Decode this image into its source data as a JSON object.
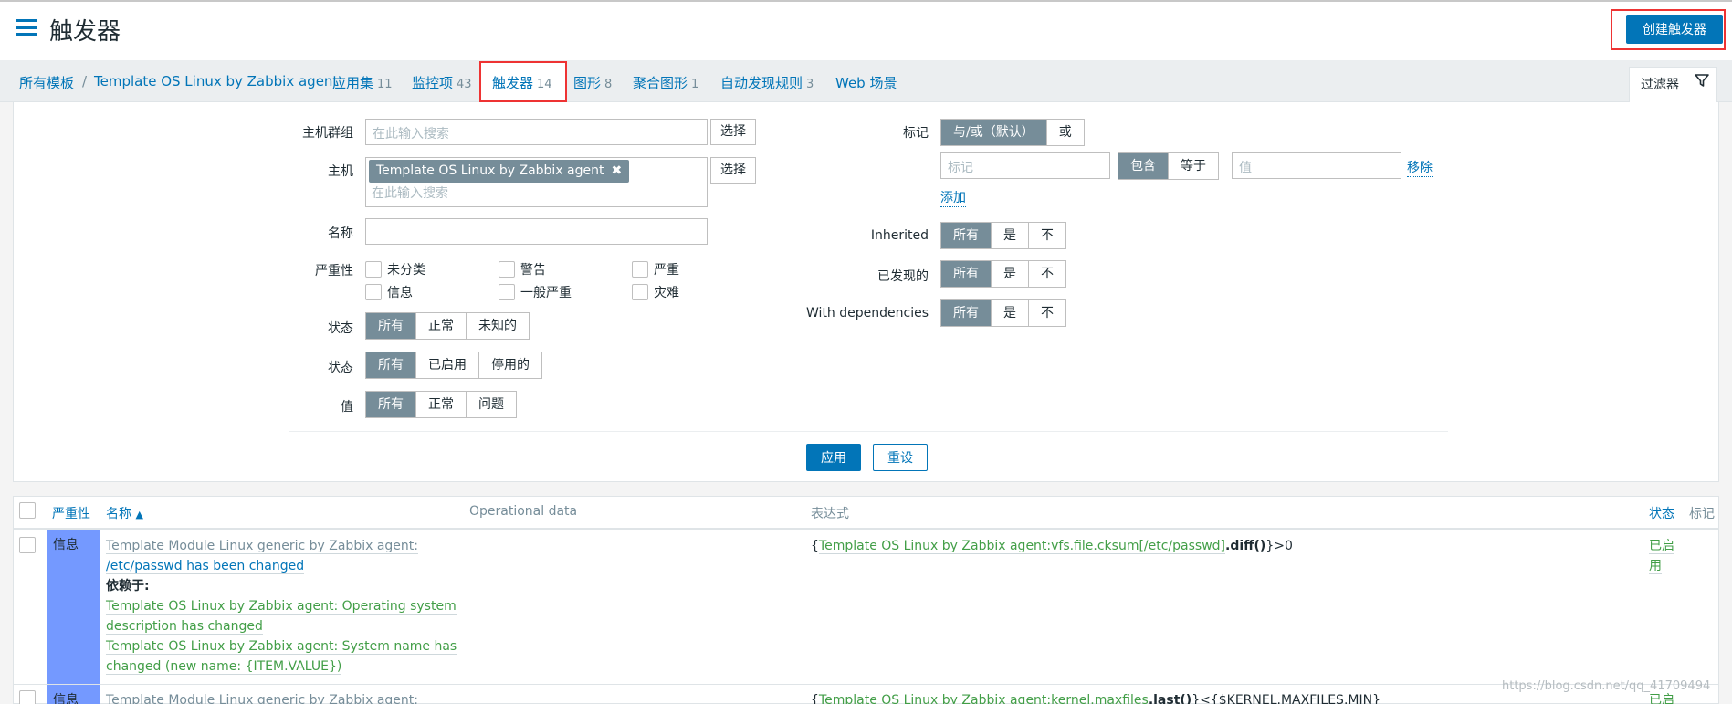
{
  "header": {
    "title": "触发器",
    "create_label": "创建触发器"
  },
  "nav": {
    "breadcrumb_all": "所有模板",
    "breadcrumb_sep": "/",
    "breadcrumb_template": "Template OS Linux by Zabbix agent",
    "tabs": [
      {
        "label": "应用集",
        "count": "11"
      },
      {
        "label": "监控项",
        "count": "43"
      },
      {
        "label": "触发器",
        "count": "14"
      },
      {
        "label": "图形",
        "count": "8"
      },
      {
        "label": "聚合图形",
        "count": "1"
      },
      {
        "label": "自动发现规则",
        "count": "3"
      },
      {
        "label": "Web 场景",
        "count": ""
      }
    ],
    "filter_tab": "过滤器"
  },
  "filter": {
    "host_group_label": "主机群组",
    "search_placeholder": "在此输入搜索",
    "select_label": "选择",
    "host_label": "主机",
    "host_chip": "Template OS Linux by Zabbix agent",
    "name_label": "名称",
    "severity_label": "严重性",
    "severities": [
      "未分类",
      "警告",
      "严重",
      "信息",
      "一般严重",
      "灾难"
    ],
    "state_label": "状态",
    "state_options": [
      "所有",
      "正常",
      "未知的"
    ],
    "status_label": "状态",
    "status_options": [
      "所有",
      "已启用",
      "停用的"
    ],
    "value_label": "值",
    "value_options": [
      "所有",
      "正常",
      "问题"
    ],
    "tags_label": "标记",
    "tags_mode": [
      "与/或（默认）",
      "或"
    ],
    "tag_placeholder": "标记",
    "tag_operator": [
      "包含",
      "等于"
    ],
    "tag_value_placeholder": "值",
    "remove_label": "移除",
    "add_label": "添加",
    "inherited_label": "Inherited",
    "discovered_label": "已发现的",
    "deps_label": "With dependencies",
    "yesno": [
      "所有",
      "是",
      "不"
    ],
    "apply_label": "应用",
    "reset_label": "重设"
  },
  "table": {
    "headers": {
      "severity": "严重性",
      "name": "名称",
      "name_sort": "▲",
      "opdata": "Operational data",
      "expression": "表达式",
      "status": "状态",
      "tags": "标记"
    },
    "rows": [
      {
        "severity": "信息",
        "name_prefix": "Template Module Linux generic by Zabbix agent:",
        "name": "/etc/passwd has been changed",
        "depends_label": "依赖于:",
        "deps": [
          [
            "Template OS Linux by Zabbix agent: Operating system",
            "description has changed"
          ],
          [
            "Template OS Linux by Zabbix agent: System name has",
            "changed (new name: {ITEM.VALUE})"
          ]
        ],
        "expr_open": "{",
        "expr_link": "Template OS Linux by Zabbix agent:vfs.file.cksum[/etc/passwd]",
        "expr_fn": ".diff()",
        "expr_tail": "}>0",
        "status": [
          "已启",
          "用"
        ]
      },
      {
        "severity": "信息",
        "name_prefix": "Template Module Linux generic by Zabbix agent:",
        "expr_open": "{",
        "expr_link": "Template OS Linux by Zabbix agent:kernel.maxfiles",
        "expr_fn": ".last()",
        "expr_tail": "}<{$KERNEL.MAXFILES.MIN}",
        "status": [
          "已启"
        ]
      }
    ]
  },
  "watermark": "https://blog.csdn.net/qq_41709494",
  "colors": {
    "accent": "#0275b8",
    "info_severity": "#7499ff",
    "enabled": "#429e47",
    "segment_active": "#768d99",
    "highlight_box": "#ee3333"
  }
}
